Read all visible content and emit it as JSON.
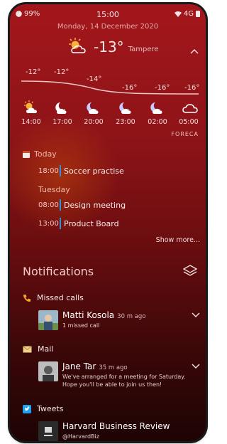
{
  "status_bar": {
    "battery": "99%",
    "time": "15:00",
    "network": "4G"
  },
  "date": "Monday, 14 December 2020",
  "weather": {
    "current_temp": "-13°",
    "location": "Tampere",
    "temps": [
      "-12°",
      "-12°",
      "-14°",
      "-16°",
      "-16°",
      "-16°"
    ],
    "hours": [
      "14:00",
      "17:00",
      "20:00",
      "23:00",
      "02:00",
      "05:00"
    ],
    "icons": [
      "sun-cloud-icon",
      "moon-cloud-icon",
      "moon-cloud-icon",
      "moon-cloud-icon",
      "moon-cloud-icon",
      "cloud-icon"
    ],
    "provider": "FORECA"
  },
  "calendar": {
    "today_label": "Today",
    "tuesday_label": "Tuesday",
    "events_today": [
      {
        "time": "18:00",
        "title": "Soccer practise"
      }
    ],
    "events_tuesday": [
      {
        "time": "08:00",
        "title": "Design meeting"
      },
      {
        "time": "13:00",
        "title": "Product Board"
      }
    ],
    "show_more": "Show more..."
  },
  "notifications": {
    "title": "Notifications",
    "missed_calls": {
      "label": "Missed calls",
      "name": "Matti Kosola",
      "ago": "30 m ago",
      "detail": "1 missed call"
    },
    "mail": {
      "label": "Mail",
      "name": "Jane Tar",
      "ago": "35 m ago",
      "detail": "We've arranged for a meeting for Saturday. Hope you'll be able to join us then!"
    },
    "tweets": {
      "label": "Tweets",
      "name": "Harvard Business Review",
      "handle": "@HarvardBiz"
    }
  },
  "colors": {
    "accent_blue": "#2f8fe0",
    "bg_top": "#a3161b",
    "bg_bottom": "#1e0404"
  }
}
